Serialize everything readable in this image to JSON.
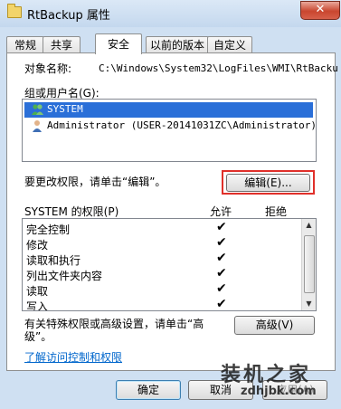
{
  "window": {
    "title": "RtBackup 属性",
    "close_glyph": "✕"
  },
  "tabs": [
    {
      "label": "常规"
    },
    {
      "label": "共享"
    },
    {
      "label": "安全"
    },
    {
      "label": "以前的版本"
    },
    {
      "label": "自定义"
    }
  ],
  "security": {
    "object_label": "对象名称:",
    "object_value": "C:\\Windows\\System32\\LogFiles\\WMI\\RtBacku",
    "groups_label": "组或用户名(G):",
    "users": [
      {
        "name": "SYSTEM"
      },
      {
        "name": "Administrator (USER-20141031ZC\\Administrator)"
      }
    ],
    "change_prompt": "要更改权限，请单击“编辑”。",
    "edit_button": "编辑(E)...",
    "perm_header": "SYSTEM 的权限(P)",
    "allow_header": "允许",
    "deny_header": "拒绝",
    "permissions": [
      {
        "name": "完全控制",
        "allow": "✔"
      },
      {
        "name": "修改",
        "allow": "✔"
      },
      {
        "name": "读取和执行",
        "allow": "✔"
      },
      {
        "name": "列出文件夹内容",
        "allow": "✔"
      },
      {
        "name": "读取",
        "allow": "✔"
      },
      {
        "name": "写入",
        "allow": "✔"
      }
    ],
    "advanced_prompt_1": "有关特殊权限或高级设置，请单击“高",
    "advanced_prompt_2": "级”。",
    "advanced_button": "高级(V)",
    "learn_link": "了解访问控制和权限"
  },
  "footer": {
    "ok": "确定",
    "cancel": "取消",
    "apply": "应用(A)"
  },
  "watermark": {
    "brand": "装机之家",
    "url": "zdhjbk.com"
  }
}
